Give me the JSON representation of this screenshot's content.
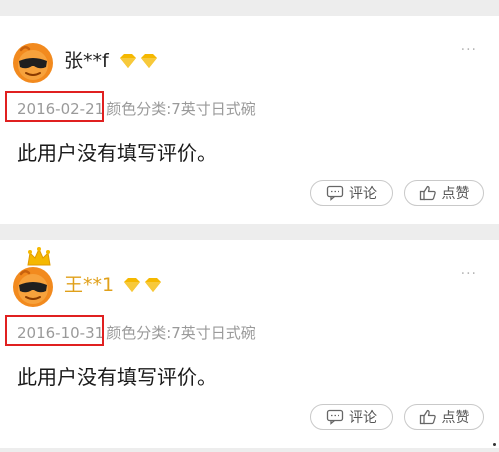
{
  "reviews": [
    {
      "username": "张**f",
      "date": "2016-02-21",
      "spec": "颜色分类:7英寸日式碗",
      "text": "此用户没有填写评价。",
      "comment_label": "评论",
      "like_label": "点赞",
      "more": "···",
      "has_crown": false
    },
    {
      "username": "王**1",
      "date": "2016-10-31",
      "spec": "颜色分类:7英寸日式碗",
      "text": "此用户没有填写评价。",
      "comment_label": "评论",
      "like_label": "点赞",
      "more": "···",
      "has_crown": true
    }
  ],
  "colors": {
    "highlight": "#e02020",
    "vip_gold": "#f5b800",
    "gold_username": "#e0a01a",
    "avatar_orange": "#f28a1e"
  },
  "icons": {
    "avatar": "sunglasses-avatar-icon",
    "crown": "crown-icon",
    "vip": "diamond-icon",
    "comment": "speech-bubble-icon",
    "like": "thumbs-up-icon",
    "more": "more-dots-icon"
  }
}
